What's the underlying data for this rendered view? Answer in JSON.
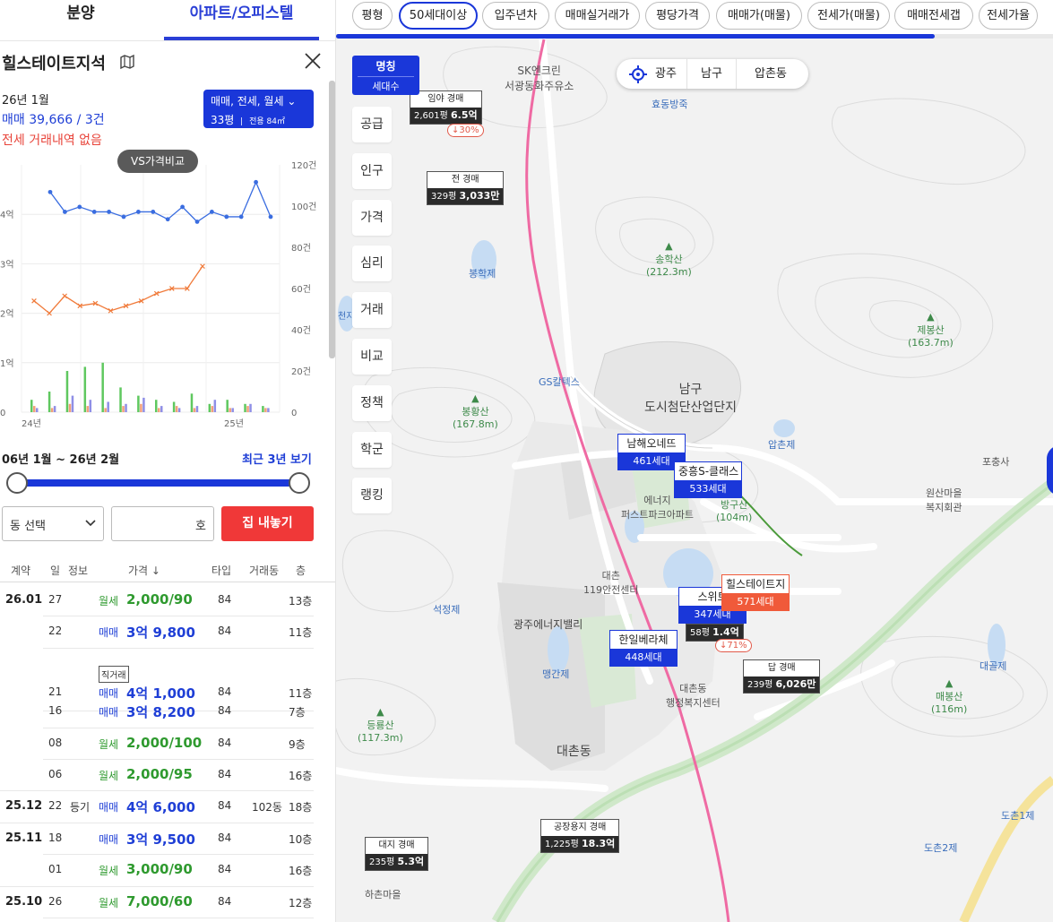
{
  "left_panel": {
    "tabs": {
      "presale": "분양",
      "apartment": "아파트/오피스텔"
    },
    "complex_title": "힐스테이트지석",
    "date": "26년 1월",
    "sale_summary": "매매 39,666 / 3건",
    "jeonse_summary": "전세 거래내역 없음",
    "filter": {
      "line1": "매매, 전세, 월세",
      "size": "33평",
      "area": "전용 84㎡"
    },
    "vs_button": "VS가격비교",
    "range_label": "06년 1월 ~ 26년 2월",
    "recent_link": "최근 3년 보기",
    "dong_select": "동 선택",
    "ho_placeholder": "호",
    "list_button": "집 내놓기",
    "table_headers": {
      "contract": "계약",
      "day": "일",
      "info": "정보",
      "price": "가격 ↓",
      "type": "타입",
      "dong": "거래동",
      "floor": "층"
    },
    "rows": [
      {
        "month": "26.01",
        "day": "27",
        "info": "",
        "type": "월세",
        "price": "2,000/90",
        "area": "84",
        "dong": "",
        "floor": "13층"
      },
      {
        "month": "",
        "day": "22",
        "info": "",
        "type": "매매",
        "price": "3억 9,800",
        "area": "84",
        "dong": "",
        "floor": "11층"
      },
      {
        "month": "",
        "day": "21",
        "info": "",
        "badge": "직거래",
        "type": "매매",
        "price": "4억 1,000",
        "area": "84",
        "dong": "",
        "floor": "11층"
      },
      {
        "month": "",
        "day": "16",
        "info": "",
        "type": "매매",
        "price": "3억 8,200",
        "area": "84",
        "dong": "",
        "floor": "7층"
      },
      {
        "month": "",
        "day": "08",
        "info": "",
        "type": "월세",
        "price": "2,000/100",
        "area": "84",
        "dong": "",
        "floor": "9층"
      },
      {
        "month": "",
        "day": "06",
        "info": "",
        "type": "월세",
        "price": "2,000/95",
        "area": "84",
        "dong": "",
        "floor": "16층"
      },
      {
        "month": "25.12",
        "day": "22",
        "info": "등기",
        "type": "매매",
        "price": "4억 6,000",
        "area": "84",
        "dong": "102동",
        "floor": "18층"
      },
      {
        "month": "25.11",
        "day": "18",
        "info": "",
        "type": "매매",
        "price": "3억 9,500",
        "area": "84",
        "dong": "",
        "floor": "10층"
      },
      {
        "month": "",
        "day": "01",
        "info": "",
        "type": "월세",
        "price": "3,000/90",
        "area": "84",
        "dong": "",
        "floor": "16층"
      },
      {
        "month": "25.10",
        "day": "26",
        "info": "",
        "type": "월세",
        "price": "7,000/60",
        "area": "84",
        "dong": "",
        "floor": "12층"
      }
    ],
    "colors": {
      "accent": "#1a37d9",
      "sale": "#1f3fd6",
      "rent": "#2f9a2f",
      "alert": "#f03838"
    }
  },
  "chart_data": {
    "type": "line",
    "x_tick_labels": [
      "24년",
      "25년"
    ],
    "y_left_ticks": [
      "0",
      "1억",
      "2억",
      "3억",
      "4억"
    ],
    "y_right_ticks": [
      "0",
      "20건",
      "40건",
      "60건",
      "80건",
      "100건",
      "120건"
    ],
    "ylim_left": [
      0,
      5
    ],
    "ylim_right": [
      0,
      120
    ],
    "grid": true,
    "series": [
      {
        "color": "#3a6de0",
        "values": [
          4.45,
          4.05,
          4.15,
          4.05,
          4.05,
          3.95,
          4.05,
          4.05,
          3.9,
          4.15,
          3.85,
          4.05,
          3.95,
          3.95,
          4.65,
          3.95
        ]
      },
      {
        "color": "#f07a3a",
        "values": [
          2.25,
          2.0,
          2.35,
          2.15,
          2.2,
          2.05,
          2.15,
          2.25,
          2.4,
          2.5,
          2.5,
          2.95
        ]
      }
    ],
    "volume_bars": {
      "colors": [
        "#5fc85f",
        "#f2a07a",
        "#8f8fe6"
      ],
      "values": [
        [
          6,
          3,
          2
        ],
        [
          10,
          2,
          3
        ],
        [
          20,
          4,
          8
        ],
        [
          22,
          3,
          6
        ],
        [
          24,
          2,
          5
        ],
        [
          12,
          3,
          4
        ],
        [
          8,
          4,
          7
        ],
        [
          6,
          2,
          3
        ],
        [
          5,
          3,
          2
        ],
        [
          9,
          2,
          3
        ],
        [
          4,
          3,
          6
        ],
        [
          6,
          2,
          2
        ],
        [
          4,
          3,
          4
        ],
        [
          3,
          2,
          2
        ]
      ]
    }
  },
  "map": {
    "filter_chips": [
      "평형",
      "50세대이상",
      "입주년차",
      "매매실거래가",
      "평당가격",
      "매매가(매물)",
      "전세가(매물)",
      "매매전세갭",
      "전세가율"
    ],
    "active_chip": "50세대이상",
    "name_toggle": {
      "line1": "명칭",
      "line2": "세대수"
    },
    "side_menu": [
      "공급",
      "인구",
      "가격",
      "심리",
      "거래",
      "비교",
      "정책",
      "학군",
      "랭킹"
    ],
    "region": {
      "city": "광주",
      "district": "남구",
      "dong": "압촌동"
    },
    "auction_markers": [
      {
        "label": "임야 경매",
        "size": "2,601평",
        "price": "6.5억"
      },
      {
        "label": "전 경매",
        "size": "329평",
        "price": "3,033만"
      },
      {
        "label": "답 경매",
        "size": "239평",
        "price": "6,026만"
      },
      {
        "label": "공장용지 경매",
        "size": "1,225평",
        "price": "18.3억"
      },
      {
        "label": "대지 경매",
        "size": "235평",
        "price": "5.3억"
      },
      {
        "label": "",
        "size": "58평",
        "price": "1.4억"
      }
    ],
    "drop_badges": [
      "↓30%",
      "↓71%"
    ],
    "apt_markers": [
      {
        "name": "남해오네뜨",
        "units": "461세대"
      },
      {
        "name": "중흥S-클래스",
        "units": "533세대"
      },
      {
        "name": "스위트",
        "units": "347세대"
      },
      {
        "name": "한일베라체",
        "units": "448세대"
      }
    ],
    "selected_marker": {
      "name": "힐스테이트지",
      "units": "571세대"
    },
    "pois": {
      "sk": "SK엔크린",
      "sk2": "서광동화주유소",
      "hyodong": "효동방죽",
      "bonghak": "봉학제",
      "songhak": "송학산",
      "songhak_h": "(212.3m)",
      "jebong": "제봉산",
      "jebong_h": "(163.7m)",
      "gs": "GS칼텍스",
      "namgu1": "남구",
      "namgu2": "도시첨단산업단지",
      "bonghwa": "봉황산",
      "bonghwa_h": "(167.8m)",
      "apchon": "압촌제",
      "pochung": "포충사",
      "wonsan1": "원산마을",
      "wonsan2": "복지회관",
      "banggu": "방구산",
      "banggu_h": "(104m)",
      "energy1": "에너지",
      "energy2": "퍼스트파크아파트",
      "daechon119a": "대촌",
      "daechon119b": "119안전센터",
      "seokjeong": "석정제",
      "energyvalley": "광주에너지밸리",
      "maengan": "맹간제",
      "daechon_office1": "대촌동",
      "daechon_office2": "행정복지센터",
      "daegol": "대골제",
      "maebong": "매봉산",
      "maebong_h": "(116m)",
      "deungryong": "등룡산",
      "deungryong_h": "(117.3m)",
      "daechondong": "대촌동",
      "dochon1": "도촌1제",
      "dochon2": "도촌2제",
      "hachon": "하촌마을",
      "cheonji": "천지"
    }
  }
}
